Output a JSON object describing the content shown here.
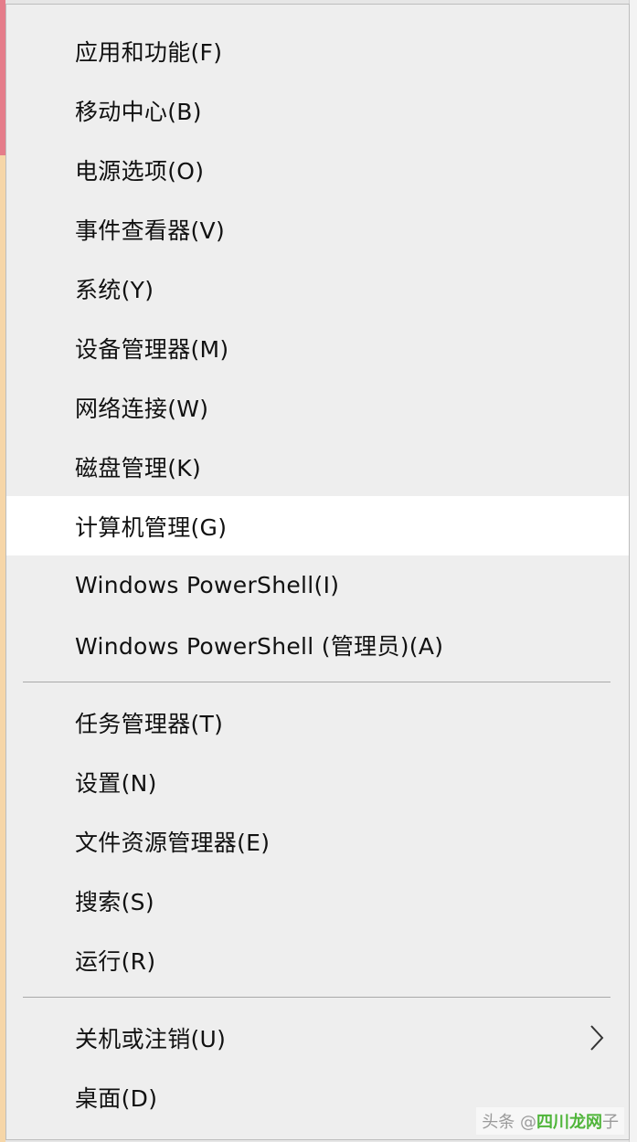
{
  "menu": {
    "group1": [
      {
        "label": "应用和功能(F)"
      },
      {
        "label": "移动中心(B)"
      },
      {
        "label": "电源选项(O)"
      },
      {
        "label": "事件查看器(V)"
      },
      {
        "label": "系统(Y)"
      },
      {
        "label": "设备管理器(M)"
      },
      {
        "label": "网络连接(W)"
      },
      {
        "label": "磁盘管理(K)"
      },
      {
        "label": "计算机管理(G)",
        "highlighted": true
      },
      {
        "label": "Windows PowerShell(I)"
      },
      {
        "label": "Windows PowerShell (管理员)(A)"
      }
    ],
    "group2": [
      {
        "label": "任务管理器(T)"
      },
      {
        "label": "设置(N)"
      },
      {
        "label": "文件资源管理器(E)"
      },
      {
        "label": "搜索(S)"
      },
      {
        "label": "运行(R)"
      }
    ],
    "group3": [
      {
        "label": "关机或注销(U)",
        "submenu_icon": "chevron-right-icon"
      },
      {
        "label": "桌面(D)"
      }
    ]
  },
  "watermark": {
    "prefix": "头条 @",
    "brand": "四川龙网",
    "suffix": "子"
  },
  "colors": {
    "menu_bg": "#eeeeee",
    "hover_bg": "#ffffff",
    "separator": "#a9a9a9",
    "text": "#111111"
  }
}
